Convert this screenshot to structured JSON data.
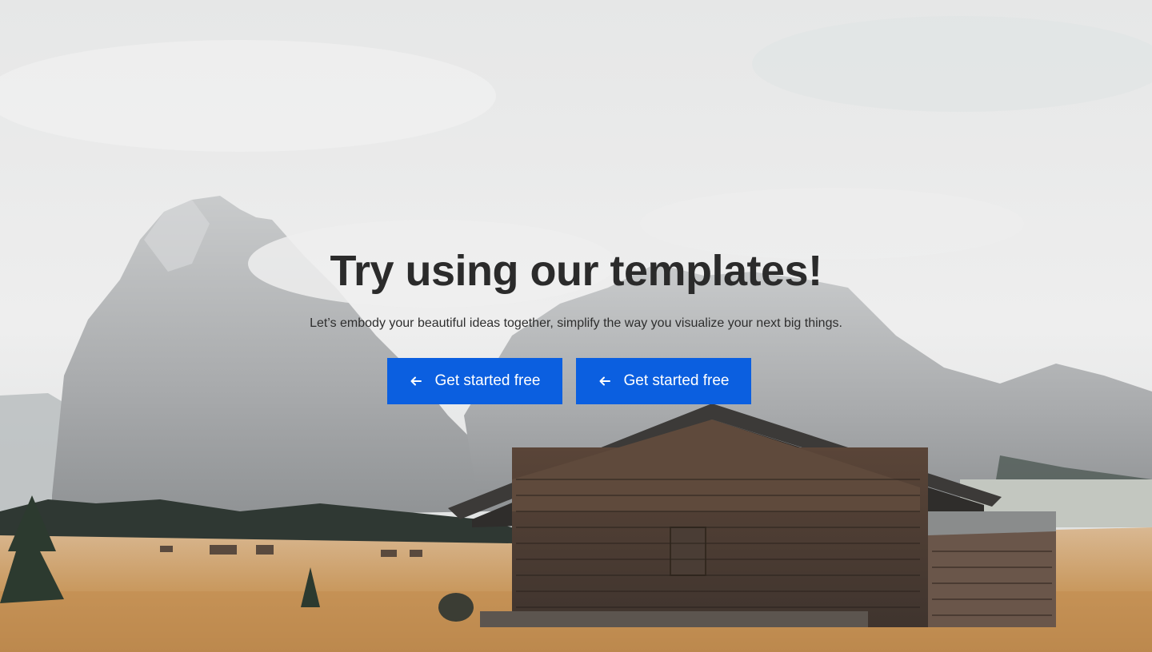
{
  "hero": {
    "title": "Try using our templates!",
    "subtitle": "Let’s embody your beautiful ideas together, simplify the way you visualize your next big things.",
    "buttons": [
      {
        "label": "Get started free",
        "icon": "arrow-left-icon"
      },
      {
        "label": "Get started free",
        "icon": "arrow-left-icon"
      }
    ],
    "colors": {
      "button": "#0b5fe0",
      "button_text": "#ffffff",
      "title": "#2b2b2b",
      "sky": "#e9eaea",
      "mountain": "#9ea1a3",
      "field": "#c89a62",
      "cabin": "#4a3c33"
    }
  }
}
